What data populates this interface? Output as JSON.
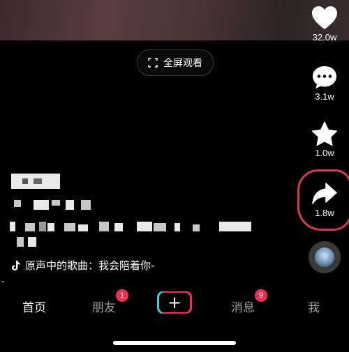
{
  "fullscreen": {
    "label": "全屏观看",
    "icon": "expand-icon"
  },
  "actions": [
    {
      "name": "like",
      "icon": "heart-icon",
      "count": "32.0w"
    },
    {
      "name": "comment",
      "icon": "comment-icon",
      "count": "3.1w"
    },
    {
      "name": "favorite",
      "icon": "star-icon",
      "count": "1.0w"
    },
    {
      "name": "share",
      "icon": "share-icon",
      "count": "1.8w"
    }
  ],
  "music": {
    "icon": "tiktok-note-icon",
    "text": "原声中的歌曲：我会陪着你-"
  },
  "tabs": [
    {
      "label": "首页",
      "active": true
    },
    {
      "label": "朋友",
      "badge": "1"
    },
    {
      "label": "消息",
      "badge": "9"
    },
    {
      "label": "我"
    }
  ],
  "create_button": {
    "icon": "plus-icon",
    "symbol": "+"
  },
  "colors": {
    "badge": "#f1304f",
    "annotation": "#d23a57",
    "accent_cyan": "#22d4e3",
    "accent_red": "#f12c55"
  }
}
